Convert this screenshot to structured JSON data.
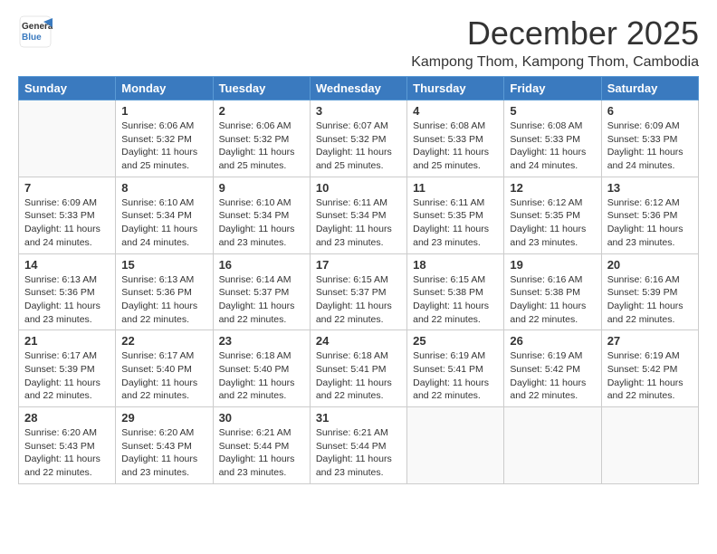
{
  "logo": {
    "general": "General",
    "blue": "Blue"
  },
  "title": {
    "month_year": "December 2025",
    "location": "Kampong Thom, Kampong Thom, Cambodia"
  },
  "days_of_week": [
    "Sunday",
    "Monday",
    "Tuesday",
    "Wednesday",
    "Thursday",
    "Friday",
    "Saturday"
  ],
  "weeks": [
    [
      {
        "day": "",
        "info": ""
      },
      {
        "day": "1",
        "info": "Sunrise: 6:06 AM\nSunset: 5:32 PM\nDaylight: 11 hours\nand 25 minutes."
      },
      {
        "day": "2",
        "info": "Sunrise: 6:06 AM\nSunset: 5:32 PM\nDaylight: 11 hours\nand 25 minutes."
      },
      {
        "day": "3",
        "info": "Sunrise: 6:07 AM\nSunset: 5:32 PM\nDaylight: 11 hours\nand 25 minutes."
      },
      {
        "day": "4",
        "info": "Sunrise: 6:08 AM\nSunset: 5:33 PM\nDaylight: 11 hours\nand 25 minutes."
      },
      {
        "day": "5",
        "info": "Sunrise: 6:08 AM\nSunset: 5:33 PM\nDaylight: 11 hours\nand 24 minutes."
      },
      {
        "day": "6",
        "info": "Sunrise: 6:09 AM\nSunset: 5:33 PM\nDaylight: 11 hours\nand 24 minutes."
      }
    ],
    [
      {
        "day": "7",
        "info": "Sunrise: 6:09 AM\nSunset: 5:33 PM\nDaylight: 11 hours\nand 24 minutes."
      },
      {
        "day": "8",
        "info": "Sunrise: 6:10 AM\nSunset: 5:34 PM\nDaylight: 11 hours\nand 24 minutes."
      },
      {
        "day": "9",
        "info": "Sunrise: 6:10 AM\nSunset: 5:34 PM\nDaylight: 11 hours\nand 23 minutes."
      },
      {
        "day": "10",
        "info": "Sunrise: 6:11 AM\nSunset: 5:34 PM\nDaylight: 11 hours\nand 23 minutes."
      },
      {
        "day": "11",
        "info": "Sunrise: 6:11 AM\nSunset: 5:35 PM\nDaylight: 11 hours\nand 23 minutes."
      },
      {
        "day": "12",
        "info": "Sunrise: 6:12 AM\nSunset: 5:35 PM\nDaylight: 11 hours\nand 23 minutes."
      },
      {
        "day": "13",
        "info": "Sunrise: 6:12 AM\nSunset: 5:36 PM\nDaylight: 11 hours\nand 23 minutes."
      }
    ],
    [
      {
        "day": "14",
        "info": "Sunrise: 6:13 AM\nSunset: 5:36 PM\nDaylight: 11 hours\nand 23 minutes."
      },
      {
        "day": "15",
        "info": "Sunrise: 6:13 AM\nSunset: 5:36 PM\nDaylight: 11 hours\nand 22 minutes."
      },
      {
        "day": "16",
        "info": "Sunrise: 6:14 AM\nSunset: 5:37 PM\nDaylight: 11 hours\nand 22 minutes."
      },
      {
        "day": "17",
        "info": "Sunrise: 6:15 AM\nSunset: 5:37 PM\nDaylight: 11 hours\nand 22 minutes."
      },
      {
        "day": "18",
        "info": "Sunrise: 6:15 AM\nSunset: 5:38 PM\nDaylight: 11 hours\nand 22 minutes."
      },
      {
        "day": "19",
        "info": "Sunrise: 6:16 AM\nSunset: 5:38 PM\nDaylight: 11 hours\nand 22 minutes."
      },
      {
        "day": "20",
        "info": "Sunrise: 6:16 AM\nSunset: 5:39 PM\nDaylight: 11 hours\nand 22 minutes."
      }
    ],
    [
      {
        "day": "21",
        "info": "Sunrise: 6:17 AM\nSunset: 5:39 PM\nDaylight: 11 hours\nand 22 minutes."
      },
      {
        "day": "22",
        "info": "Sunrise: 6:17 AM\nSunset: 5:40 PM\nDaylight: 11 hours\nand 22 minutes."
      },
      {
        "day": "23",
        "info": "Sunrise: 6:18 AM\nSunset: 5:40 PM\nDaylight: 11 hours\nand 22 minutes."
      },
      {
        "day": "24",
        "info": "Sunrise: 6:18 AM\nSunset: 5:41 PM\nDaylight: 11 hours\nand 22 minutes."
      },
      {
        "day": "25",
        "info": "Sunrise: 6:19 AM\nSunset: 5:41 PM\nDaylight: 11 hours\nand 22 minutes."
      },
      {
        "day": "26",
        "info": "Sunrise: 6:19 AM\nSunset: 5:42 PM\nDaylight: 11 hours\nand 22 minutes."
      },
      {
        "day": "27",
        "info": "Sunrise: 6:19 AM\nSunset: 5:42 PM\nDaylight: 11 hours\nand 22 minutes."
      }
    ],
    [
      {
        "day": "28",
        "info": "Sunrise: 6:20 AM\nSunset: 5:43 PM\nDaylight: 11 hours\nand 22 minutes."
      },
      {
        "day": "29",
        "info": "Sunrise: 6:20 AM\nSunset: 5:43 PM\nDaylight: 11 hours\nand 23 minutes."
      },
      {
        "day": "30",
        "info": "Sunrise: 6:21 AM\nSunset: 5:44 PM\nDaylight: 11 hours\nand 23 minutes."
      },
      {
        "day": "31",
        "info": "Sunrise: 6:21 AM\nSunset: 5:44 PM\nDaylight: 11 hours\nand 23 minutes."
      },
      {
        "day": "",
        "info": ""
      },
      {
        "day": "",
        "info": ""
      },
      {
        "day": "",
        "info": ""
      }
    ]
  ]
}
